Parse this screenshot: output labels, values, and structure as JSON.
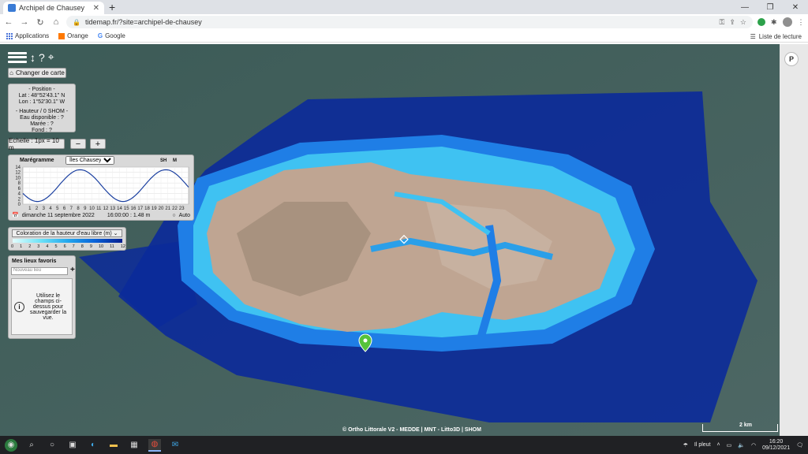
{
  "browser": {
    "tab_title": "Archipel de Chausey",
    "url": "tidemap.fr/?site=archipel-de-chausey",
    "bookmarks": [
      "Applications",
      "Orange",
      "Google"
    ],
    "reading_list": "Liste de lecture"
  },
  "map": {
    "change_map": "Changer de carte",
    "position": {
      "title": "- Position -",
      "lat": "Lat : 48°52'43.1'' N",
      "lon": "Lon : 1°52'30.1'' W",
      "height_title": "- Hauteur / 0 SHOM -",
      "water": "Eau disponible : ?",
      "tide": "Marée : ?",
      "bottom": "Fond : ?"
    },
    "scale_label": "Echelle : 1px = 10 m",
    "zoom_out": "−",
    "zoom_in": "+",
    "maregramme": {
      "title": "Marégramme",
      "station": "Îles Chausey",
      "tag1": "SH",
      "tag2": "M",
      "yticks": [
        "14",
        "12",
        "10",
        "8",
        "6",
        "4",
        "2",
        "0"
      ],
      "xticks": [
        "1",
        "2",
        "3",
        "4",
        "5",
        "6",
        "7",
        "8",
        "9",
        "10",
        "11",
        "12",
        "13",
        "14",
        "15",
        "16",
        "17",
        "18",
        "19",
        "20",
        "21",
        "22",
        "23"
      ],
      "date": "dimanche 11 septembre 2022",
      "time_value": "16:00:00 : 1.48 m",
      "auto": "Auto"
    },
    "coloration": {
      "title": "Coloration de la hauteur d'eau libre (m)",
      "ticks": [
        "0",
        "1",
        "2",
        "3",
        "4",
        "5",
        "6",
        "7",
        "8",
        "9",
        "10",
        "11",
        "12"
      ]
    },
    "favorites": {
      "title": "Mes lieux favoris",
      "placeholder": "Nouveau lieu",
      "add": "+",
      "info": "Utilisez le champs ci-dessus pour sauvegarder la vue."
    },
    "attribution": "© Ortho Littorale V2 - MEDDE | MNT - Litto3D | SHOM",
    "scale_bar": "2 km",
    "profile_btn": "P"
  },
  "taskbar": {
    "weather": "Il pleut",
    "time": "16:20",
    "date": "09/12/2021"
  }
}
